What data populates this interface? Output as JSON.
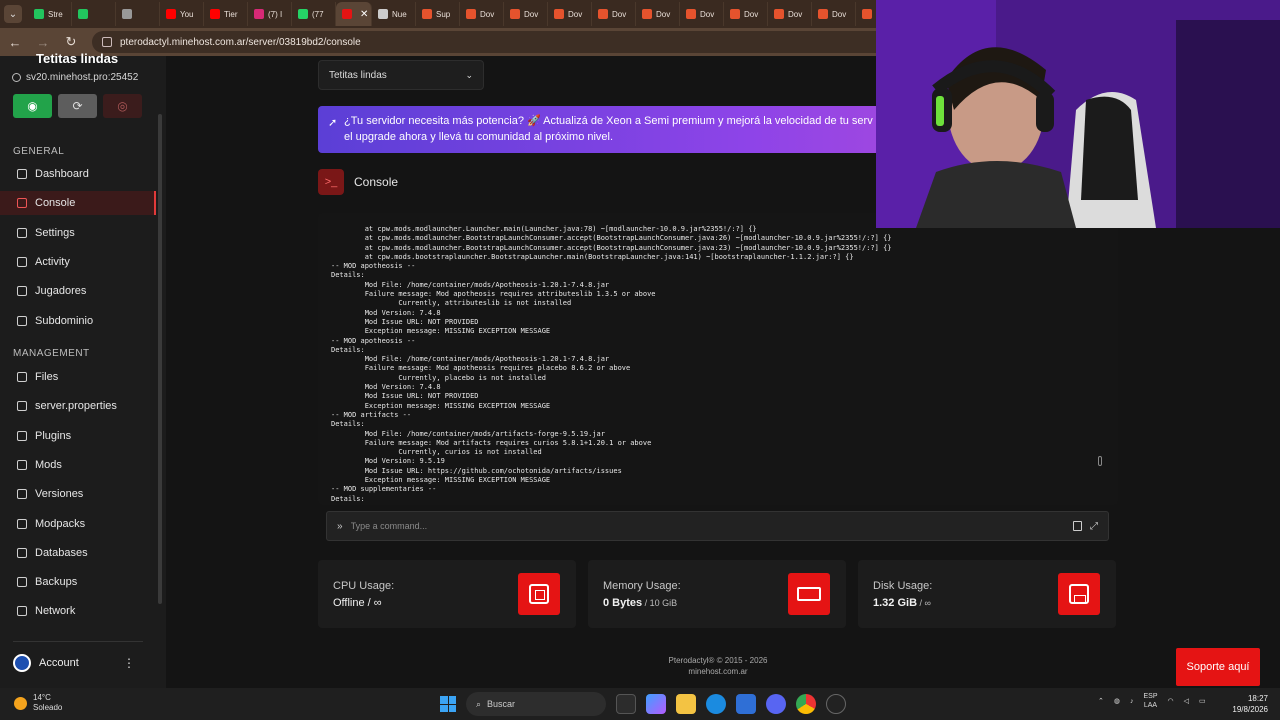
{
  "browser": {
    "tabs": [
      {
        "label": "Stre",
        "color": "#22c55e"
      },
      {
        "label": "",
        "color": "#22c55e"
      },
      {
        "label": "",
        "color": "#999999"
      },
      {
        "label": "You",
        "color": "#ff0000"
      },
      {
        "label": "Tier",
        "color": "#ff0000"
      },
      {
        "label": "(7) I",
        "color": "#d62976"
      },
      {
        "label": "(77",
        "color": "#25d366"
      },
      {
        "label": "",
        "color": "#e51414",
        "active": true
      },
      {
        "label": "Nue",
        "color": "#cccccc"
      },
      {
        "label": "Sup",
        "color": "#e5532d"
      },
      {
        "label": "Dov",
        "color": "#e5532d"
      },
      {
        "label": "Dov",
        "color": "#e5532d"
      },
      {
        "label": "Dov",
        "color": "#e5532d"
      },
      {
        "label": "Dov",
        "color": "#e5532d"
      },
      {
        "label": "Dov",
        "color": "#e5532d"
      },
      {
        "label": "Dov",
        "color": "#e5532d"
      },
      {
        "label": "Dov",
        "color": "#e5532d"
      },
      {
        "label": "Dov",
        "color": "#e5532d"
      },
      {
        "label": "Dov",
        "color": "#e5532d"
      },
      {
        "label": "Dov",
        "color": "#e5532d"
      }
    ],
    "url": "pterodactyl.minehost.com.ar/server/03819bd2/console"
  },
  "sidebar": {
    "server_name": "Tetitas lindas",
    "server_address": "sv20.minehost.pro:25452",
    "general_title": "GENERAL",
    "general_items": [
      {
        "label": "Dashboard",
        "icon": "grid-icon"
      },
      {
        "label": "Console",
        "icon": "terminal-icon",
        "active": true
      },
      {
        "label": "Settings",
        "icon": "gear-icon"
      },
      {
        "label": "Activity",
        "icon": "eye-icon"
      },
      {
        "label": "Jugadores",
        "icon": "users-icon"
      },
      {
        "label": "Subdominio",
        "icon": "link-icon"
      }
    ],
    "management_title": "MANAGEMENT",
    "management_items": [
      {
        "label": "Files",
        "icon": "folder-icon"
      },
      {
        "label": "server.properties",
        "icon": "file-icon"
      },
      {
        "label": "Plugins",
        "icon": "puzzle-icon"
      },
      {
        "label": "Mods",
        "icon": "sparkle-icon"
      },
      {
        "label": "Versiones",
        "icon": "layers-icon"
      },
      {
        "label": "Modpacks",
        "icon": "box-icon"
      },
      {
        "label": "Databases",
        "icon": "database-icon"
      },
      {
        "label": "Backups",
        "icon": "archive-icon"
      },
      {
        "label": "Network",
        "icon": "network-icon"
      }
    ],
    "account_label": "Account"
  },
  "main": {
    "server_select_value": "Tetitas lindas",
    "promo_text_line1": "¿Tu servidor necesita más potencia? 🚀 Actualizá de Xeon a Semi premium y mejorá la velocidad de tu serv",
    "promo_text_line2": "el upgrade ahora y llevá tu comunidad al próximo nivel.",
    "console_title": "Console",
    "console_lines": [
      "        at cpw.mods.modlauncher.Launcher.main(Launcher.java:78) ~[modlauncher-10.0.9.jar%2355!/:?] {}",
      "        at cpw.mods.modlauncher.BootstrapLaunchConsumer.accept(BootstrapLaunchConsumer.java:26) ~[modlauncher-10.0.9.jar%2355!/:?] {}",
      "        at cpw.mods.modlauncher.BootstrapLaunchConsumer.accept(BootstrapLaunchConsumer.java:23) ~[modlauncher-10.0.9.jar%2355!/:?] {}",
      "        at cpw.mods.bootstraplauncher.BootstrapLauncher.main(BootstrapLauncher.java:141) ~[bootstraplauncher-1.1.2.jar:?] {}",
      "-- MOD apotheosis --",
      "Details:",
      "        Mod File: /home/container/mods/Apotheosis-1.20.1-7.4.8.jar",
      "        Failure message: Mod apotheosis requires attributeslib 1.3.5 or above",
      "                Currently, attributeslib is not installed",
      "        Mod Version: 7.4.8",
      "        Mod Issue URL: NOT PROVIDED",
      "        Exception message: MISSING EXCEPTION MESSAGE",
      "-- MOD apotheosis --",
      "Details:",
      "        Mod File: /home/container/mods/Apotheosis-1.20.1-7.4.8.jar",
      "        Failure message: Mod apotheosis requires placebo 8.6.2 or above",
      "                Currently, placebo is not installed",
      "        Mod Version: 7.4.8",
      "        Mod Issue URL: NOT PROVIDED",
      "        Exception message: MISSING EXCEPTION MESSAGE",
      "-- MOD artifacts --",
      "Details:",
      "        Mod File: /home/container/mods/artifacts-forge-9.5.19.jar",
      "        Failure message: Mod artifacts requires curios 5.8.1+1.20.1 or above",
      "                Currently, curios is not installed",
      "        Mod Version: 9.5.19",
      "        Mod Issue URL: https://github.com/ochotonida/artifacts/issues",
      "        Exception message: MISSING EXCEPTION MESSAGE",
      "-- MOD supplementaries --",
      "Details:"
    ],
    "command_placeholder": "Type a command...",
    "stats": {
      "cpu_label": "CPU Usage:",
      "cpu_value": "Offline",
      "cpu_limit": " / ∞",
      "memory_label": "Memory Usage:",
      "memory_value": "0 Bytes",
      "memory_limit": " / 10 GiB",
      "disk_label": "Disk Usage:",
      "disk_value": "1.32 GiB",
      "disk_limit": " / ∞"
    },
    "footer_line1": "Pterodactyl® © 2015 - 2026",
    "footer_line2": "minehost.com.ar",
    "support_button": "Soporte aquí"
  },
  "taskbar": {
    "weather_temp": "14°C",
    "weather_desc": "Soleado",
    "search_label": "Buscar",
    "lang_line1": "ESP",
    "lang_line2": "LAA",
    "time": "18:27",
    "date": "19/8/2026"
  }
}
